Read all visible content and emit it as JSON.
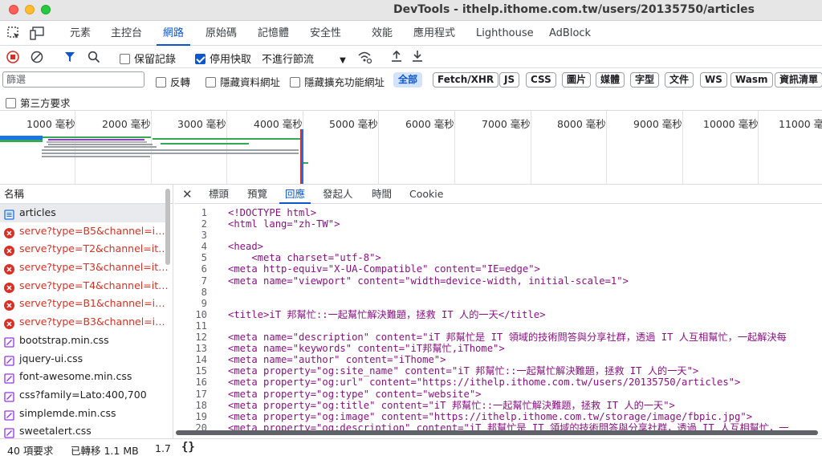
{
  "window": {
    "title": "DevTools - ithelp.ithome.com.tw/users/20135750/articles"
  },
  "panel_tabs": [
    "元素",
    "主控台",
    "網路",
    "原始碼",
    "記憶體",
    "安全性",
    "效能",
    "應用程式",
    "Lighthouse",
    "AdBlock"
  ],
  "panel_tabs_active": "網路",
  "toolbar": {
    "preserve_log": "保留記錄",
    "preserve_log_checked": false,
    "disable_cache": "停用快取",
    "disable_cache_checked": true,
    "throttle": "不進行節流"
  },
  "filter": {
    "placeholder": "篩選",
    "invert": "反轉",
    "hide_data_urls": "隱藏資料網址",
    "hide_extension_urls": "隱藏擴充功能網址",
    "types": [
      "全部",
      "Fetch/XHR",
      "JS",
      "CSS",
      "圖片",
      "媒體",
      "字型",
      "文件",
      "WS",
      "Wasm",
      "資訊清單"
    ],
    "active_type": "全部",
    "third_party": "第三方要求"
  },
  "timeline": {
    "ticks": [
      "1000 毫秒",
      "2000 毫秒",
      "3000 毫秒",
      "4000 毫秒",
      "5000 毫秒",
      "6000 毫秒",
      "7000 毫秒",
      "8000 毫秒",
      "9000 毫秒",
      "10000 毫秒",
      "11000 毫秒"
    ]
  },
  "requests": {
    "header": "名稱",
    "rows": [
      {
        "name": "articles",
        "kind": "doc",
        "selected": true
      },
      {
        "name": "serve?type=B5&channel=itho…",
        "kind": "error"
      },
      {
        "name": "serve?type=T2&channel=itho…",
        "kind": "error"
      },
      {
        "name": "serve?type=T3&channel=itho…",
        "kind": "error"
      },
      {
        "name": "serve?type=T4&channel=itho…",
        "kind": "error"
      },
      {
        "name": "serve?type=B1&channel=itho…",
        "kind": "error"
      },
      {
        "name": "serve?type=B3&channel=itho…",
        "kind": "error"
      },
      {
        "name": "bootstrap.min.css",
        "kind": "css"
      },
      {
        "name": "jquery-ui.css",
        "kind": "css"
      },
      {
        "name": "font-awesome.min.css",
        "kind": "css"
      },
      {
        "name": "css?family=Lato:400,700",
        "kind": "css"
      },
      {
        "name": "simplemde.min.css",
        "kind": "css"
      },
      {
        "name": "sweetalert.css",
        "kind": "css"
      }
    ]
  },
  "detail": {
    "tabs": [
      "標頭",
      "預覽",
      "回應",
      "發起人",
      "時間",
      "Cookie"
    ],
    "active_tab": "回應",
    "lines": [
      {
        "n": "1",
        "text": "<!DOCTYPE html>"
      },
      {
        "n": "2",
        "text": "<html lang=\"zh-TW\">"
      },
      {
        "n": "3",
        "text": ""
      },
      {
        "n": "4",
        "text": "<head>"
      },
      {
        "n": "5",
        "text": "    <meta charset=\"utf-8\">"
      },
      {
        "n": "6",
        "text": "<meta http-equiv=\"X-UA-Compatible\" content=\"IE=edge\">"
      },
      {
        "n": "7",
        "text": "<meta name=\"viewport\" content=\"width=device-width, initial-scale=1\">"
      },
      {
        "n": "8",
        "text": ""
      },
      {
        "n": "9",
        "text": ""
      },
      {
        "n": "10",
        "text": "<title>iT 邦幫忙::一起幫忙解決難題，拯救 IT 人的一天</title>"
      },
      {
        "n": "11",
        "text": ""
      },
      {
        "n": "12",
        "text": "<meta name=\"description\" content=\"iT 邦幫忙是 IT 領域的技術問答與分享社群，透過 IT 人互相幫忙，一起解決每"
      },
      {
        "n": "13",
        "text": "<meta name=\"keywords\" content=\"iT邦幫忙,iThome\">"
      },
      {
        "n": "14",
        "text": "<meta name=\"author\" content=\"iThome\">"
      },
      {
        "n": "15",
        "text": "<meta property=\"og:site_name\" content=\"iT 邦幫忙::一起幫忙解決難題，拯救 IT 人的一天\">"
      },
      {
        "n": "16",
        "text": "<meta property=\"og:url\" content=\"https://ithelp.ithome.com.tw/users/20135750/articles\">"
      },
      {
        "n": "17",
        "text": "<meta property=\"og:type\" content=\"website\">"
      },
      {
        "n": "18",
        "text": "<meta property=\"og:title\" content=\"iT 邦幫忙::一起幫忙解決難題，拯救 IT 人的一天\">"
      },
      {
        "n": "19",
        "text": "<meta property=\"og:image\" content=\"https://ithelp.ithome.com.tw/storage/image/fbpic.jpg\">"
      },
      {
        "n": "20",
        "text": "<meta property=\"og:description\" content=\"iT 邦幫忙是 IT 領域的技術問答與分享社群，透過 IT 人互相幫忙，一"
      }
    ]
  },
  "status": {
    "requests": "40 項要求",
    "transferred": "已轉移 1.1 MB",
    "resources": "1.7",
    "format": "{}"
  },
  "colors": {
    "accent": "#0b57d0",
    "error": "#d93025",
    "tag": "#881280",
    "attr": "#994500",
    "value": "#1a1aa6"
  }
}
